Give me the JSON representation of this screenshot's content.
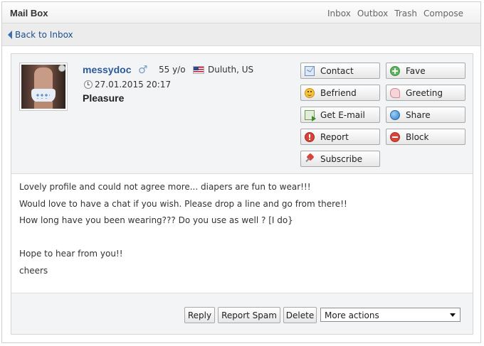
{
  "window": {
    "title": "Mail Box"
  },
  "topnav": [
    "Inbox",
    "Outbox",
    "Trash",
    "Compose"
  ],
  "back_link": "Back to Inbox",
  "sender": {
    "username": "messydoc",
    "gender_icon": "male-icon",
    "age": "55 y/o",
    "flag_icon": "us-flag-icon",
    "location": "Duluth, US",
    "online_status": "offline"
  },
  "message": {
    "datetime": "27.01.2015 20:17",
    "subject": "Pleasure",
    "lines": [
      "Lovely profile and could not agree more... diapers are fun to wear!!!",
      "Would love to have a chat if you wish. Please drop a line and go from there!!",
      "How long have you been wearing??? Do you use as well ? [I do}",
      "",
      "Hope to hear from you!!",
      "cheers"
    ]
  },
  "actions": {
    "contact": "Contact",
    "fave": "Fave",
    "befriend": "Befriend",
    "greeting": "Greeting",
    "get_email": "Get E-mail",
    "share": "Share",
    "report": "Report",
    "block": "Block",
    "subscribe": "Subscribe"
  },
  "footer": {
    "reply": "Reply",
    "report_spam": "Report Spam",
    "delete": "Delete",
    "more_actions": "More actions"
  },
  "colors": {
    "link": "#2a5a9a",
    "panel_bg": "#f2f4f6",
    "border": "#d4d4d4"
  }
}
